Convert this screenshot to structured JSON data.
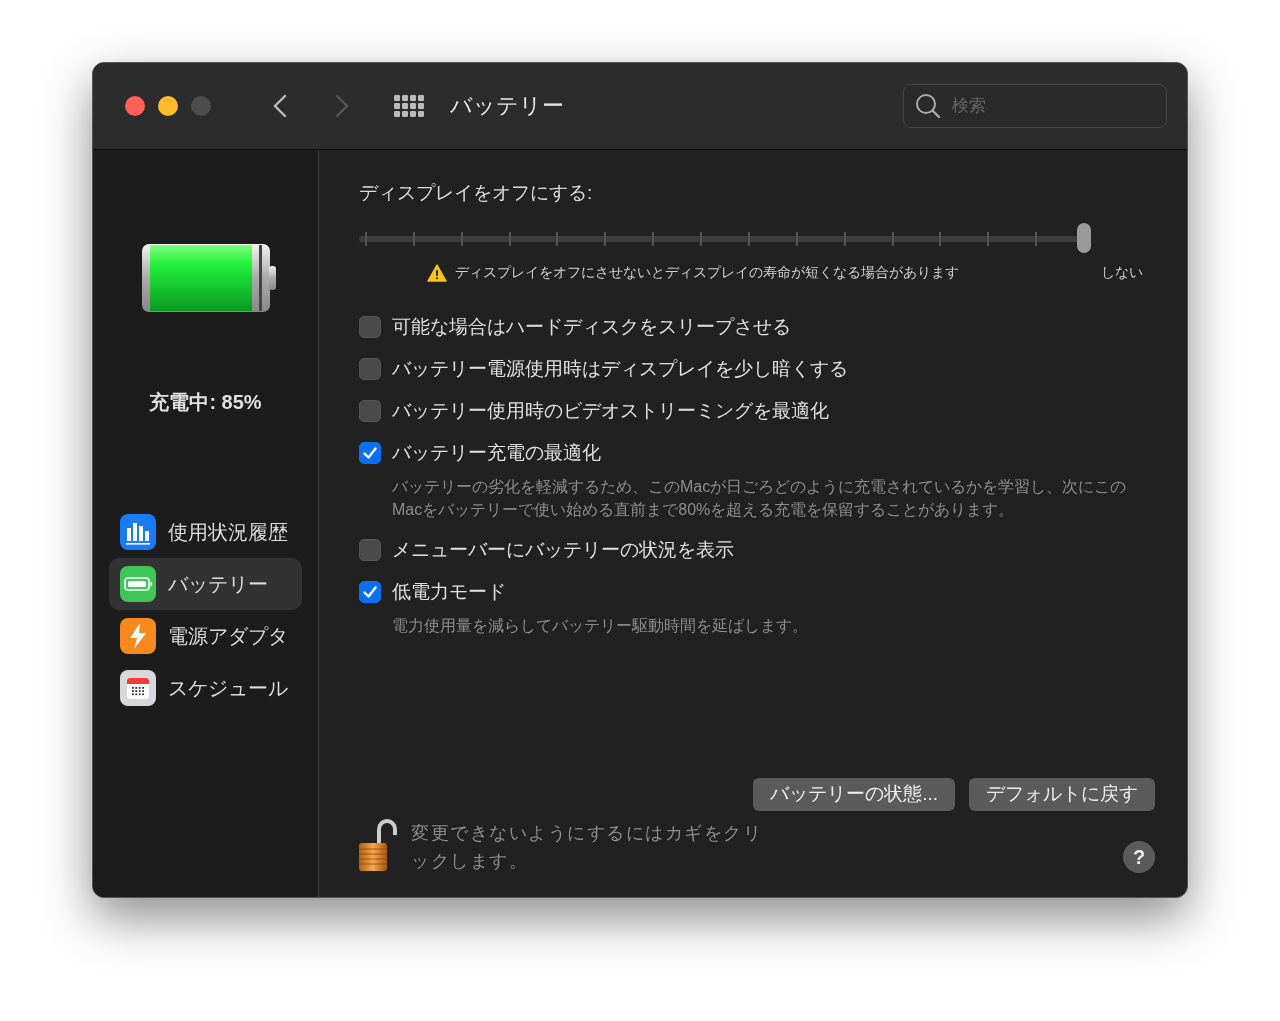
{
  "window": {
    "title": "バッテリー"
  },
  "search": {
    "placeholder": "検索"
  },
  "sidebar": {
    "status": "充電中: 85%",
    "items": [
      {
        "label": "使用状況履歴",
        "kind": "usage",
        "selected": false
      },
      {
        "label": "バッテリー",
        "kind": "battery",
        "selected": true
      },
      {
        "label": "電源アダプタ",
        "kind": "adapter",
        "selected": false
      },
      {
        "label": "スケジュール",
        "kind": "schedule",
        "selected": false
      }
    ]
  },
  "display_off": {
    "label": "ディスプレイをオフにする:",
    "level": 1,
    "warning": "ディスプレイをオフにさせないとディスプレイの寿命が短くなる場合があります",
    "end_label": "しない"
  },
  "options": [
    {
      "label": "可能な場合はハードディスクをスリープさせる",
      "checked": false
    },
    {
      "label": "バッテリー電源使用時はディスプレイを少し暗くする",
      "checked": false
    },
    {
      "label": "バッテリー使用時のビデオストリーミングを最適化",
      "checked": false
    },
    {
      "label": "バッテリー充電の最適化",
      "checked": true,
      "description": "バッテリーの劣化を軽減するため、このMacが日ごろどのように充電されているかを学習し、次にこのMacをバッテリーで使い始める直前まで80%を超える充電を保留することがあります。"
    },
    {
      "label": "メニューバーにバッテリーの状況を表示",
      "checked": false
    },
    {
      "label": "低電力モード",
      "checked": true,
      "description": "電力使用量を減らしてバッテリー駆動時間を延ばします。"
    }
  ],
  "buttons": [
    "バッテリーの状態...",
    "デフォルトに戻す"
  ],
  "lock_text": "変更できないようにするにはカギをクリックします。",
  "help": "?"
}
